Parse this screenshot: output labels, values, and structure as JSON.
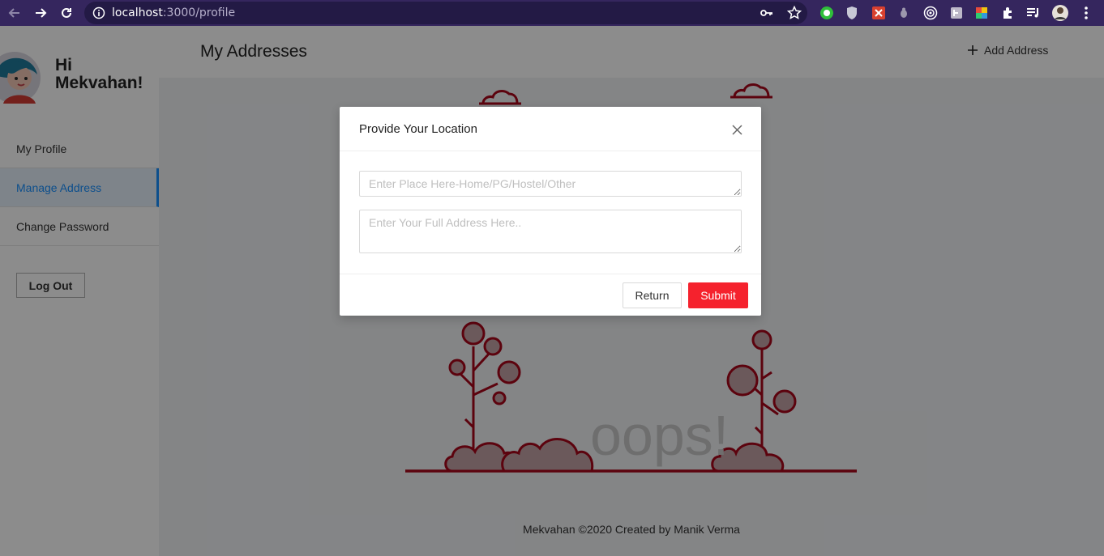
{
  "browser": {
    "url_host": "localhost",
    "url_path": ":3000/profile",
    "icons": [
      "back-icon",
      "forward-icon",
      "reload-icon",
      "info-icon",
      "key-icon",
      "star-icon",
      "extensions-icon",
      "media-icon",
      "profile-avatar-icon",
      "more-icon"
    ]
  },
  "sidebar": {
    "greeting_line1": "Hi",
    "greeting_line2": "Mekvahan!",
    "items": [
      {
        "label": "My Profile"
      },
      {
        "label": "Manage Address"
      },
      {
        "label": "Change Password"
      }
    ],
    "logout_label": "Log Out"
  },
  "main": {
    "title": "My Addresses",
    "add_address_label": "Add Address",
    "empty_text": "oops!",
    "footer": "Mekvahan ©2020 Created by Manik Verma"
  },
  "modal": {
    "title": "Provide Your Location",
    "place_placeholder": "Enter Place Here-Home/PG/Hostel/Other",
    "address_placeholder": "Enter Your Full Address Here..",
    "return_label": "Return",
    "submit_label": "Submit"
  },
  "colors": {
    "browser_bar": "#35265e",
    "accent": "#1890ff",
    "submit": "#f5222d",
    "illustration": "#a8071a"
  }
}
